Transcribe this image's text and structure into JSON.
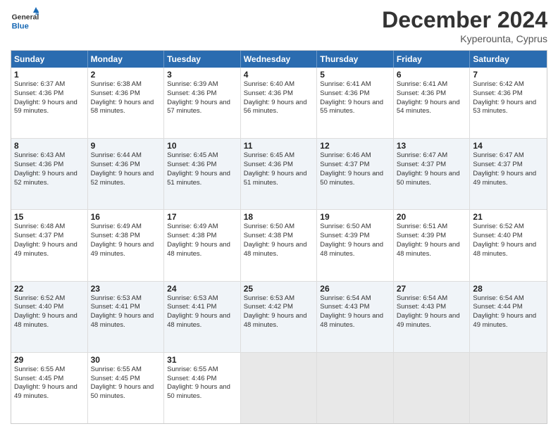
{
  "header": {
    "title": "December 2024",
    "location": "Kyperounta, Cyprus",
    "logo_line1": "General",
    "logo_line2": "Blue"
  },
  "days_of_week": [
    "Sunday",
    "Monday",
    "Tuesday",
    "Wednesday",
    "Thursday",
    "Friday",
    "Saturday"
  ],
  "weeks": [
    [
      {
        "day": 1,
        "sunrise": "6:37 AM",
        "sunset": "4:36 PM",
        "daylight": "9 hours and 59 minutes."
      },
      {
        "day": 2,
        "sunrise": "6:38 AM",
        "sunset": "4:36 PM",
        "daylight": "9 hours and 58 minutes."
      },
      {
        "day": 3,
        "sunrise": "6:39 AM",
        "sunset": "4:36 PM",
        "daylight": "9 hours and 57 minutes."
      },
      {
        "day": 4,
        "sunrise": "6:40 AM",
        "sunset": "4:36 PM",
        "daylight": "9 hours and 56 minutes."
      },
      {
        "day": 5,
        "sunrise": "6:41 AM",
        "sunset": "4:36 PM",
        "daylight": "9 hours and 55 minutes."
      },
      {
        "day": 6,
        "sunrise": "6:41 AM",
        "sunset": "4:36 PM",
        "daylight": "9 hours and 54 minutes."
      },
      {
        "day": 7,
        "sunrise": "6:42 AM",
        "sunset": "4:36 PM",
        "daylight": "9 hours and 53 minutes."
      }
    ],
    [
      {
        "day": 8,
        "sunrise": "6:43 AM",
        "sunset": "4:36 PM",
        "daylight": "9 hours and 52 minutes."
      },
      {
        "day": 9,
        "sunrise": "6:44 AM",
        "sunset": "4:36 PM",
        "daylight": "9 hours and 52 minutes."
      },
      {
        "day": 10,
        "sunrise": "6:45 AM",
        "sunset": "4:36 PM",
        "daylight": "9 hours and 51 minutes."
      },
      {
        "day": 11,
        "sunrise": "6:45 AM",
        "sunset": "4:36 PM",
        "daylight": "9 hours and 51 minutes."
      },
      {
        "day": 12,
        "sunrise": "6:46 AM",
        "sunset": "4:37 PM",
        "daylight": "9 hours and 50 minutes."
      },
      {
        "day": 13,
        "sunrise": "6:47 AM",
        "sunset": "4:37 PM",
        "daylight": "9 hours and 50 minutes."
      },
      {
        "day": 14,
        "sunrise": "6:47 AM",
        "sunset": "4:37 PM",
        "daylight": "9 hours and 49 minutes."
      }
    ],
    [
      {
        "day": 15,
        "sunrise": "6:48 AM",
        "sunset": "4:37 PM",
        "daylight": "9 hours and 49 minutes."
      },
      {
        "day": 16,
        "sunrise": "6:49 AM",
        "sunset": "4:38 PM",
        "daylight": "9 hours and 49 minutes."
      },
      {
        "day": 17,
        "sunrise": "6:49 AM",
        "sunset": "4:38 PM",
        "daylight": "9 hours and 48 minutes."
      },
      {
        "day": 18,
        "sunrise": "6:50 AM",
        "sunset": "4:38 PM",
        "daylight": "9 hours and 48 minutes."
      },
      {
        "day": 19,
        "sunrise": "6:50 AM",
        "sunset": "4:39 PM",
        "daylight": "9 hours and 48 minutes."
      },
      {
        "day": 20,
        "sunrise": "6:51 AM",
        "sunset": "4:39 PM",
        "daylight": "9 hours and 48 minutes."
      },
      {
        "day": 21,
        "sunrise": "6:52 AM",
        "sunset": "4:40 PM",
        "daylight": "9 hours and 48 minutes."
      }
    ],
    [
      {
        "day": 22,
        "sunrise": "6:52 AM",
        "sunset": "4:40 PM",
        "daylight": "9 hours and 48 minutes."
      },
      {
        "day": 23,
        "sunrise": "6:53 AM",
        "sunset": "4:41 PM",
        "daylight": "9 hours and 48 minutes."
      },
      {
        "day": 24,
        "sunrise": "6:53 AM",
        "sunset": "4:41 PM",
        "daylight": "9 hours and 48 minutes."
      },
      {
        "day": 25,
        "sunrise": "6:53 AM",
        "sunset": "4:42 PM",
        "daylight": "9 hours and 48 minutes."
      },
      {
        "day": 26,
        "sunrise": "6:54 AM",
        "sunset": "4:43 PM",
        "daylight": "9 hours and 48 minutes."
      },
      {
        "day": 27,
        "sunrise": "6:54 AM",
        "sunset": "4:43 PM",
        "daylight": "9 hours and 49 minutes."
      },
      {
        "day": 28,
        "sunrise": "6:54 AM",
        "sunset": "4:44 PM",
        "daylight": "9 hours and 49 minutes."
      }
    ],
    [
      {
        "day": 29,
        "sunrise": "6:55 AM",
        "sunset": "4:45 PM",
        "daylight": "9 hours and 49 minutes."
      },
      {
        "day": 30,
        "sunrise": "6:55 AM",
        "sunset": "4:45 PM",
        "daylight": "9 hours and 50 minutes."
      },
      {
        "day": 31,
        "sunrise": "6:55 AM",
        "sunset": "4:46 PM",
        "daylight": "9 hours and 50 minutes."
      },
      null,
      null,
      null,
      null
    ]
  ]
}
